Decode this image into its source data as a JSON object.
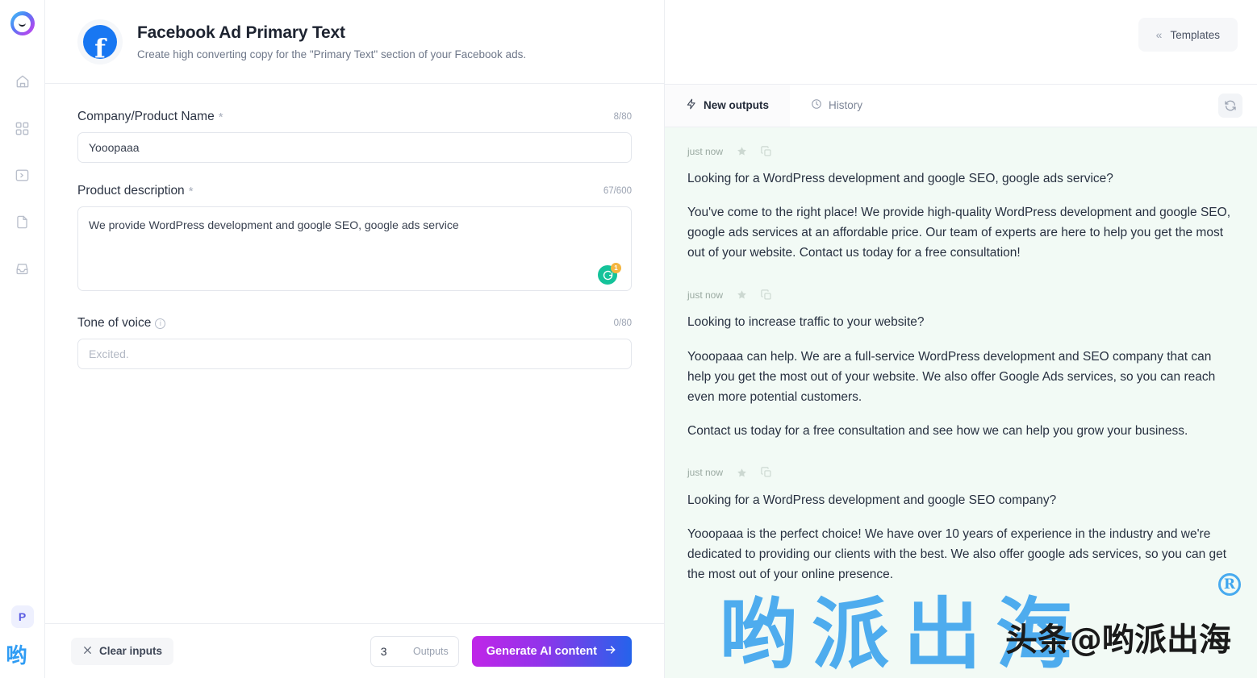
{
  "sidebar": {
    "logo_name": "app-logo",
    "items": [
      {
        "icon": "home-icon",
        "name": "sidebar-item-home"
      },
      {
        "icon": "grid-apps-icon",
        "name": "sidebar-item-apps"
      },
      {
        "icon": "terminal-icon",
        "name": "sidebar-item-playground"
      },
      {
        "icon": "document-icon",
        "name": "sidebar-item-documents"
      },
      {
        "icon": "inbox-icon",
        "name": "sidebar-item-inbox"
      }
    ],
    "avatar_label": "P"
  },
  "header": {
    "icon": "facebook-icon",
    "title": "Facebook Ad Primary Text",
    "subtitle": "Create high converting copy for the \"Primary Text\" section of your Facebook ads.",
    "templates_label": "Templates",
    "templates_icon": "double-chevron-left-icon"
  },
  "form": {
    "fields": [
      {
        "label": "Company/Product Name",
        "required": "*",
        "counter": "8/80",
        "value": "Yooopaaa",
        "placeholder": ""
      },
      {
        "label": "Product description",
        "required": "*",
        "counter": "67/600",
        "value": "We provide WordPress development and google SEO, google ads service",
        "placeholder": "",
        "grammarly_badge": "1"
      },
      {
        "label": "Tone of voice",
        "required": "",
        "counter": "0/80",
        "value": "",
        "placeholder": "Excited."
      }
    ]
  },
  "bottom_bar": {
    "clear_label": "Clear inputs",
    "clear_icon": "close-icon",
    "outputs_value": "3",
    "outputs_label": "Outputs",
    "generate_label": "Generate AI content",
    "generate_icon": "arrow-right-icon"
  },
  "tabs": [
    {
      "label": "New outputs",
      "icon": "lightning-icon",
      "active": true
    },
    {
      "label": "History",
      "icon": "clock-icon",
      "active": false
    }
  ],
  "refresh_icon": "refresh-icon",
  "outputs": [
    {
      "time": "just now",
      "paragraphs": [
        "Looking for a WordPress development and google SEO, google ads service?",
        "You've come to the right place! We provide high-quality WordPress development and google SEO, google ads services at an affordable price. Our team of experts are here to help you get the most out of your website. Contact us today for a free consultation!"
      ]
    },
    {
      "time": "just now",
      "paragraphs": [
        "Looking to increase traffic to your website?",
        "Yooopaaa can help. We are a full-service WordPress development and SEO company that can help you get the most out of your website. We also offer Google Ads services, so you can reach even more potential customers.",
        "Contact us today for a free consultation and see how we can help you grow your business."
      ]
    },
    {
      "time": "just now",
      "paragraphs": [
        "Looking for a WordPress development and google SEO company?",
        "Yooopaaa is the perfect choice! We have over 10 years of experience in the industry and we're dedicated to providing our clients with the best. We also offer google ads services, so you can get the most out of your online presence."
      ]
    }
  ],
  "watermark": {
    "cjk": "哟派出海",
    "registered": "R",
    "handle": "头条@哟派出海",
    "sidebar_mark": "哟"
  },
  "colors": {
    "brand_facebook": "#1877f2",
    "generate_start": "#c026e8",
    "generate_end": "#2563eb",
    "outputs_bg": "#f2faf5",
    "grammarly_green": "#15c39a",
    "grammarly_badge": "#f4b53f",
    "watermark_blue": "#299bed"
  }
}
